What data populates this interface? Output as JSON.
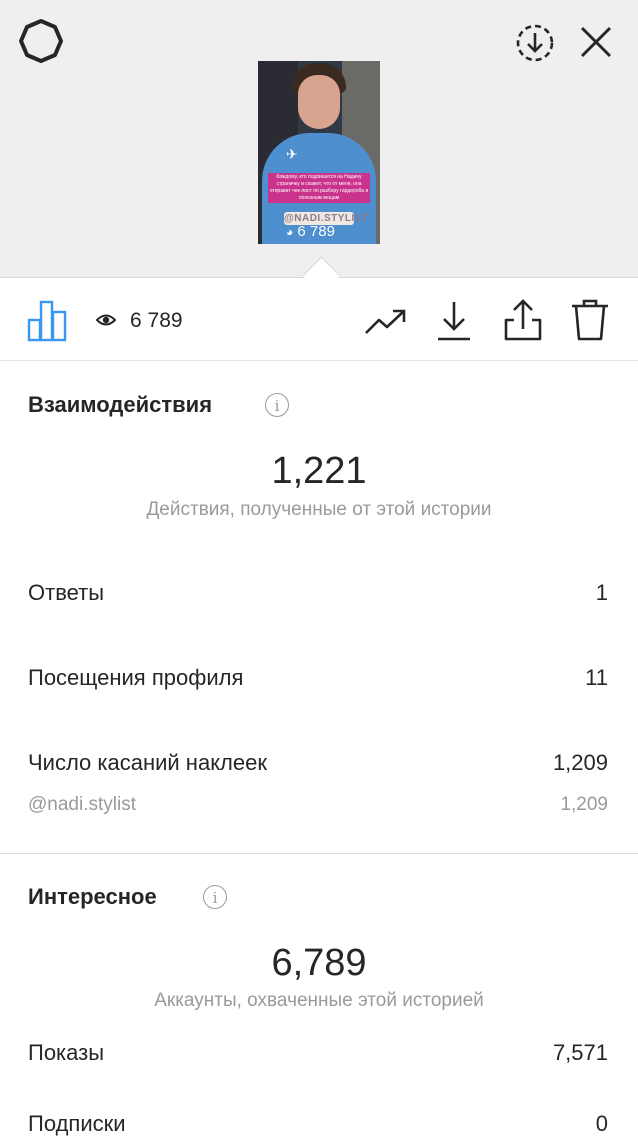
{
  "story": {
    "caption_text": "Каждому, кто подпишется на Надину страничку и скажет, что от меня, она отправит чек-лист по разбору гардероба и полезным вещам",
    "sticker_text": "@NADI.STYLIST",
    "overlay_views": "6 789"
  },
  "toolbar": {
    "view_count": "6 789",
    "icons": [
      "bar-chart-icon",
      "eye-icon",
      "trending-icon",
      "download-icon",
      "share-icon",
      "trash-icon"
    ]
  },
  "header_icons": [
    "settings-icon",
    "download-circle-icon",
    "close-icon"
  ],
  "interactions": {
    "title": "Взаимодействия",
    "info_glyph": "i",
    "total": "1,221",
    "total_caption": "Действия, полученные от этой истории",
    "rows": [
      {
        "label": "Ответы",
        "value": "1"
      },
      {
        "label": "Посещения профиля",
        "value": "11"
      },
      {
        "label": "Число касаний наклеек",
        "value": "1,209"
      }
    ],
    "sticker_row": {
      "label": "@nadi.stylist",
      "value": "1,209"
    }
  },
  "discovery": {
    "title": "Интересное",
    "info_glyph": "i",
    "total": "6,789",
    "total_caption": "Аккаунты, охваченные этой историей",
    "rows": [
      {
        "label": "Показы",
        "value": "7,571"
      },
      {
        "label": "Подписки",
        "value": "0"
      }
    ]
  },
  "colors": {
    "accent": "#3897f0",
    "text": "#262626",
    "secondary": "#9a9a9a",
    "preview_bg": "#efefef",
    "caption_bg": "#c9338d"
  }
}
